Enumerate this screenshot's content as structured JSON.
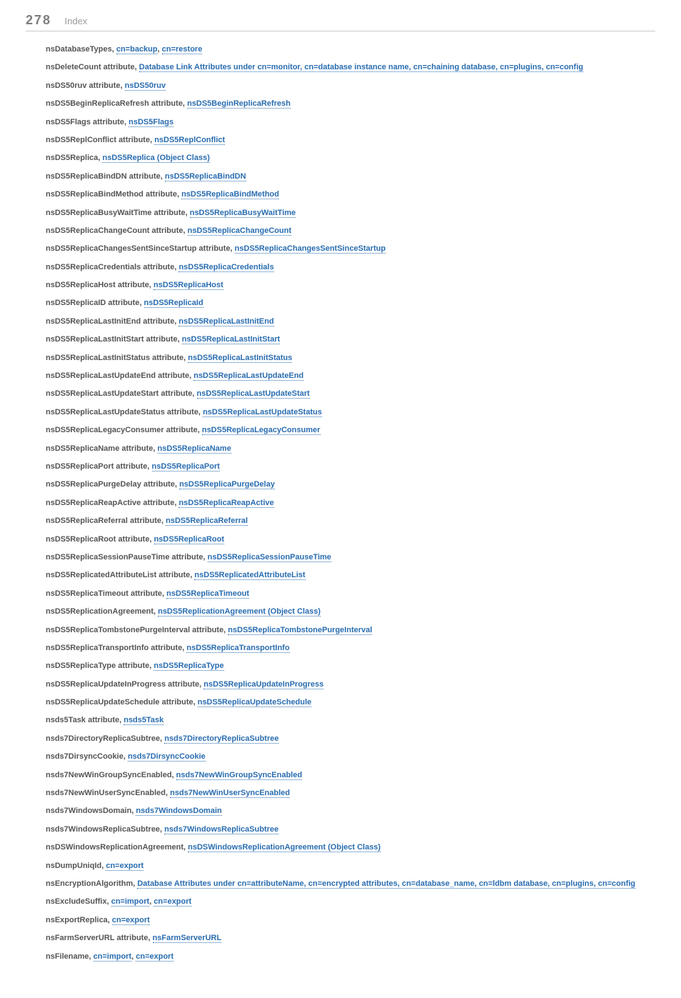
{
  "header": {
    "page_number": "278",
    "title": "Index"
  },
  "entries": [
    {
      "parts": [
        {
          "kind": "plain",
          "text": "nsDatabaseTypes, "
        },
        {
          "kind": "link",
          "text": "cn=backup"
        },
        {
          "kind": "plain",
          "text": ", "
        },
        {
          "kind": "link",
          "text": "cn=restore"
        }
      ]
    },
    {
      "parts": [
        {
          "kind": "plain",
          "text": "nsDeleteCount attribute, "
        },
        {
          "kind": "link",
          "text": "Database Link Attributes under cn=monitor, cn=database instance name, cn=chaining database, cn=plugins, cn=config"
        }
      ]
    },
    {
      "parts": [
        {
          "kind": "plain",
          "text": "nsDS50ruv attribute, "
        },
        {
          "kind": "link",
          "text": "nsDS50ruv"
        }
      ]
    },
    {
      "parts": [
        {
          "kind": "plain",
          "text": "nsDS5BeginReplicaRefresh attribute, "
        },
        {
          "kind": "link",
          "text": "nsDS5BeginReplicaRefresh"
        }
      ]
    },
    {
      "parts": [
        {
          "kind": "plain",
          "text": "nsDS5Flags attribute, "
        },
        {
          "kind": "link",
          "text": "nsDS5Flags"
        }
      ]
    },
    {
      "parts": [
        {
          "kind": "plain",
          "text": "nsDS5ReplConflict attribute, "
        },
        {
          "kind": "link",
          "text": "nsDS5ReplConflict"
        }
      ]
    },
    {
      "parts": [
        {
          "kind": "plain",
          "text": "nsDS5Replica, "
        },
        {
          "kind": "link",
          "text": "nsDS5Replica (Object Class)"
        }
      ]
    },
    {
      "parts": [
        {
          "kind": "plain",
          "text": "nsDS5ReplicaBindDN attribute, "
        },
        {
          "kind": "link",
          "text": "nsDS5ReplicaBindDN"
        }
      ]
    },
    {
      "parts": [
        {
          "kind": "plain",
          "text": "nsDS5ReplicaBindMethod attribute, "
        },
        {
          "kind": "link",
          "text": "nsDS5ReplicaBindMethod"
        }
      ]
    },
    {
      "parts": [
        {
          "kind": "plain",
          "text": "nsDS5ReplicaBusyWaitTime attribute, "
        },
        {
          "kind": "link",
          "text": "nsDS5ReplicaBusyWaitTime"
        }
      ]
    },
    {
      "parts": [
        {
          "kind": "plain",
          "text": "nsDS5ReplicaChangeCount attribute, "
        },
        {
          "kind": "link",
          "text": "nsDS5ReplicaChangeCount"
        }
      ]
    },
    {
      "parts": [
        {
          "kind": "plain",
          "text": "nsDS5ReplicaChangesSentSinceStartup attribute, "
        },
        {
          "kind": "link",
          "text": "nsDS5ReplicaChangesSentSinceStartup"
        }
      ]
    },
    {
      "parts": [
        {
          "kind": "plain",
          "text": "nsDS5ReplicaCredentials attribute, "
        },
        {
          "kind": "link",
          "text": "nsDS5ReplicaCredentials"
        }
      ]
    },
    {
      "parts": [
        {
          "kind": "plain",
          "text": "nsDS5ReplicaHost attribute, "
        },
        {
          "kind": "link",
          "text": "nsDS5ReplicaHost"
        }
      ]
    },
    {
      "parts": [
        {
          "kind": "plain",
          "text": "nsDS5ReplicaID attribute, "
        },
        {
          "kind": "link",
          "text": "nsDS5ReplicaId"
        }
      ]
    },
    {
      "parts": [
        {
          "kind": "plain",
          "text": "nsDS5ReplicaLastInitEnd attribute, "
        },
        {
          "kind": "link",
          "text": "nsDS5ReplicaLastInitEnd"
        }
      ]
    },
    {
      "parts": [
        {
          "kind": "plain",
          "text": "nsDS5ReplicaLastInitStart attribute, "
        },
        {
          "kind": "link",
          "text": "nsDS5ReplicaLastInitStart"
        }
      ]
    },
    {
      "parts": [
        {
          "kind": "plain",
          "text": "nsDS5ReplicaLastInitStatus attribute, "
        },
        {
          "kind": "link",
          "text": "nsDS5ReplicaLastInitStatus"
        }
      ]
    },
    {
      "parts": [
        {
          "kind": "plain",
          "text": "nsDS5ReplicaLastUpdateEnd attribute, "
        },
        {
          "kind": "link",
          "text": "nsDS5ReplicaLastUpdateEnd"
        }
      ]
    },
    {
      "parts": [
        {
          "kind": "plain",
          "text": "nsDS5ReplicaLastUpdateStart attribute, "
        },
        {
          "kind": "link",
          "text": "nsDS5ReplicaLastUpdateStart"
        }
      ]
    },
    {
      "parts": [
        {
          "kind": "plain",
          "text": "nsDS5ReplicaLastUpdateStatus attribute, "
        },
        {
          "kind": "link",
          "text": "nsDS5ReplicaLastUpdateStatus"
        }
      ]
    },
    {
      "parts": [
        {
          "kind": "plain",
          "text": "nsDS5ReplicaLegacyConsumer attribute, "
        },
        {
          "kind": "link",
          "text": "nsDS5ReplicaLegacyConsumer"
        }
      ]
    },
    {
      "parts": [
        {
          "kind": "plain",
          "text": "nsDS5ReplicaName attribute, "
        },
        {
          "kind": "link",
          "text": "nsDS5ReplicaName"
        }
      ]
    },
    {
      "parts": [
        {
          "kind": "plain",
          "text": "nsDS5ReplicaPort attribute, "
        },
        {
          "kind": "link",
          "text": "nsDS5ReplicaPort"
        }
      ]
    },
    {
      "parts": [
        {
          "kind": "plain",
          "text": "nsDS5ReplicaPurgeDelay attribute, "
        },
        {
          "kind": "link",
          "text": "nsDS5ReplicaPurgeDelay"
        }
      ]
    },
    {
      "parts": [
        {
          "kind": "plain",
          "text": "nsDS5ReplicaReapActive attribute, "
        },
        {
          "kind": "link",
          "text": "nsDS5ReplicaReapActive"
        }
      ]
    },
    {
      "parts": [
        {
          "kind": "plain",
          "text": "nsDS5ReplicaReferral attribute, "
        },
        {
          "kind": "link",
          "text": "nsDS5ReplicaReferral"
        }
      ]
    },
    {
      "parts": [
        {
          "kind": "plain",
          "text": "nsDS5ReplicaRoot attribute, "
        },
        {
          "kind": "link",
          "text": "nsDS5ReplicaRoot"
        }
      ]
    },
    {
      "parts": [
        {
          "kind": "plain",
          "text": "nsDS5ReplicaSessionPauseTime attribute, "
        },
        {
          "kind": "link",
          "text": "nsDS5ReplicaSessionPauseTime"
        }
      ]
    },
    {
      "parts": [
        {
          "kind": "plain",
          "text": "nsDS5ReplicatedAttributeList attribute, "
        },
        {
          "kind": "link",
          "text": "nsDS5ReplicatedAttributeList"
        }
      ]
    },
    {
      "parts": [
        {
          "kind": "plain",
          "text": "nsDS5ReplicaTimeout attribute, "
        },
        {
          "kind": "link",
          "text": "nsDS5ReplicaTimeout"
        }
      ]
    },
    {
      "parts": [
        {
          "kind": "plain",
          "text": "nsDS5ReplicationAgreement, "
        },
        {
          "kind": "link",
          "text": "nsDS5ReplicationAgreement (Object Class)"
        }
      ]
    },
    {
      "parts": [
        {
          "kind": "plain",
          "text": "nsDS5ReplicaTombstonePurgeInterval attribute, "
        },
        {
          "kind": "link",
          "text": "nsDS5ReplicaTombstonePurgeInterval"
        }
      ]
    },
    {
      "parts": [
        {
          "kind": "plain",
          "text": "nsDS5ReplicaTransportInfo attribute, "
        },
        {
          "kind": "link",
          "text": "nsDS5ReplicaTransportInfo"
        }
      ]
    },
    {
      "parts": [
        {
          "kind": "plain",
          "text": "nsDS5ReplicaType attribute, "
        },
        {
          "kind": "link",
          "text": "nsDS5ReplicaType"
        }
      ]
    },
    {
      "parts": [
        {
          "kind": "plain",
          "text": "nsDS5ReplicaUpdateInProgress attribute, "
        },
        {
          "kind": "link",
          "text": "nsDS5ReplicaUpdateInProgress"
        }
      ]
    },
    {
      "parts": [
        {
          "kind": "plain",
          "text": "nsDS5ReplicaUpdateSchedule attribute, "
        },
        {
          "kind": "link",
          "text": "nsDS5ReplicaUpdateSchedule"
        }
      ]
    },
    {
      "parts": [
        {
          "kind": "plain",
          "text": "nsds5Task attribute, "
        },
        {
          "kind": "link",
          "text": "nsds5Task"
        }
      ]
    },
    {
      "parts": [
        {
          "kind": "plain",
          "text": "nsds7DirectoryReplicaSubtree, "
        },
        {
          "kind": "link",
          "text": "nsds7DirectoryReplicaSubtree"
        }
      ]
    },
    {
      "parts": [
        {
          "kind": "plain",
          "text": "nsds7DirsyncCookie, "
        },
        {
          "kind": "link",
          "text": "nsds7DirsyncCookie"
        }
      ]
    },
    {
      "parts": [
        {
          "kind": "plain",
          "text": "nsds7NewWinGroupSyncEnabled, "
        },
        {
          "kind": "link",
          "text": "nsds7NewWinGroupSyncEnabled"
        }
      ]
    },
    {
      "parts": [
        {
          "kind": "plain",
          "text": "nsds7NewWinUserSyncEnabled, "
        },
        {
          "kind": "link",
          "text": "nsds7NewWinUserSyncEnabled"
        }
      ]
    },
    {
      "parts": [
        {
          "kind": "plain",
          "text": "nsds7WindowsDomain, "
        },
        {
          "kind": "link",
          "text": "nsds7WindowsDomain"
        }
      ]
    },
    {
      "parts": [
        {
          "kind": "plain",
          "text": "nsds7WindowsReplicaSubtree, "
        },
        {
          "kind": "link",
          "text": "nsds7WindowsReplicaSubtree"
        }
      ]
    },
    {
      "parts": [
        {
          "kind": "plain",
          "text": "nsDSWindowsReplicationAgreement, "
        },
        {
          "kind": "link",
          "text": "nsDSWindowsReplicationAgreement (Object Class)"
        }
      ]
    },
    {
      "parts": [
        {
          "kind": "plain",
          "text": "nsDumpUniqId, "
        },
        {
          "kind": "link",
          "text": "cn=export"
        }
      ]
    },
    {
      "parts": [
        {
          "kind": "plain",
          "text": "nsEncryptionAlgorithm, "
        },
        {
          "kind": "link",
          "text": "Database Attributes under cn=attributeName, cn=encrypted attributes, cn=database_name, cn=ldbm database, cn=plugins, cn=config"
        }
      ]
    },
    {
      "parts": [
        {
          "kind": "plain",
          "text": "nsExcludeSuffix, "
        },
        {
          "kind": "link",
          "text": "cn=import"
        },
        {
          "kind": "plain",
          "text": ", "
        },
        {
          "kind": "link",
          "text": "cn=export"
        }
      ]
    },
    {
      "parts": [
        {
          "kind": "plain",
          "text": "nsExportReplica, "
        },
        {
          "kind": "link",
          "text": "cn=export"
        }
      ]
    },
    {
      "parts": [
        {
          "kind": "plain",
          "text": "nsFarmServerURL attribute, "
        },
        {
          "kind": "link",
          "text": "nsFarmServerURL"
        }
      ]
    },
    {
      "parts": [
        {
          "kind": "plain",
          "text": "nsFilename, "
        },
        {
          "kind": "link",
          "text": "cn=import"
        },
        {
          "kind": "plain",
          "text": ", "
        },
        {
          "kind": "link",
          "text": "cn=export"
        }
      ]
    }
  ]
}
